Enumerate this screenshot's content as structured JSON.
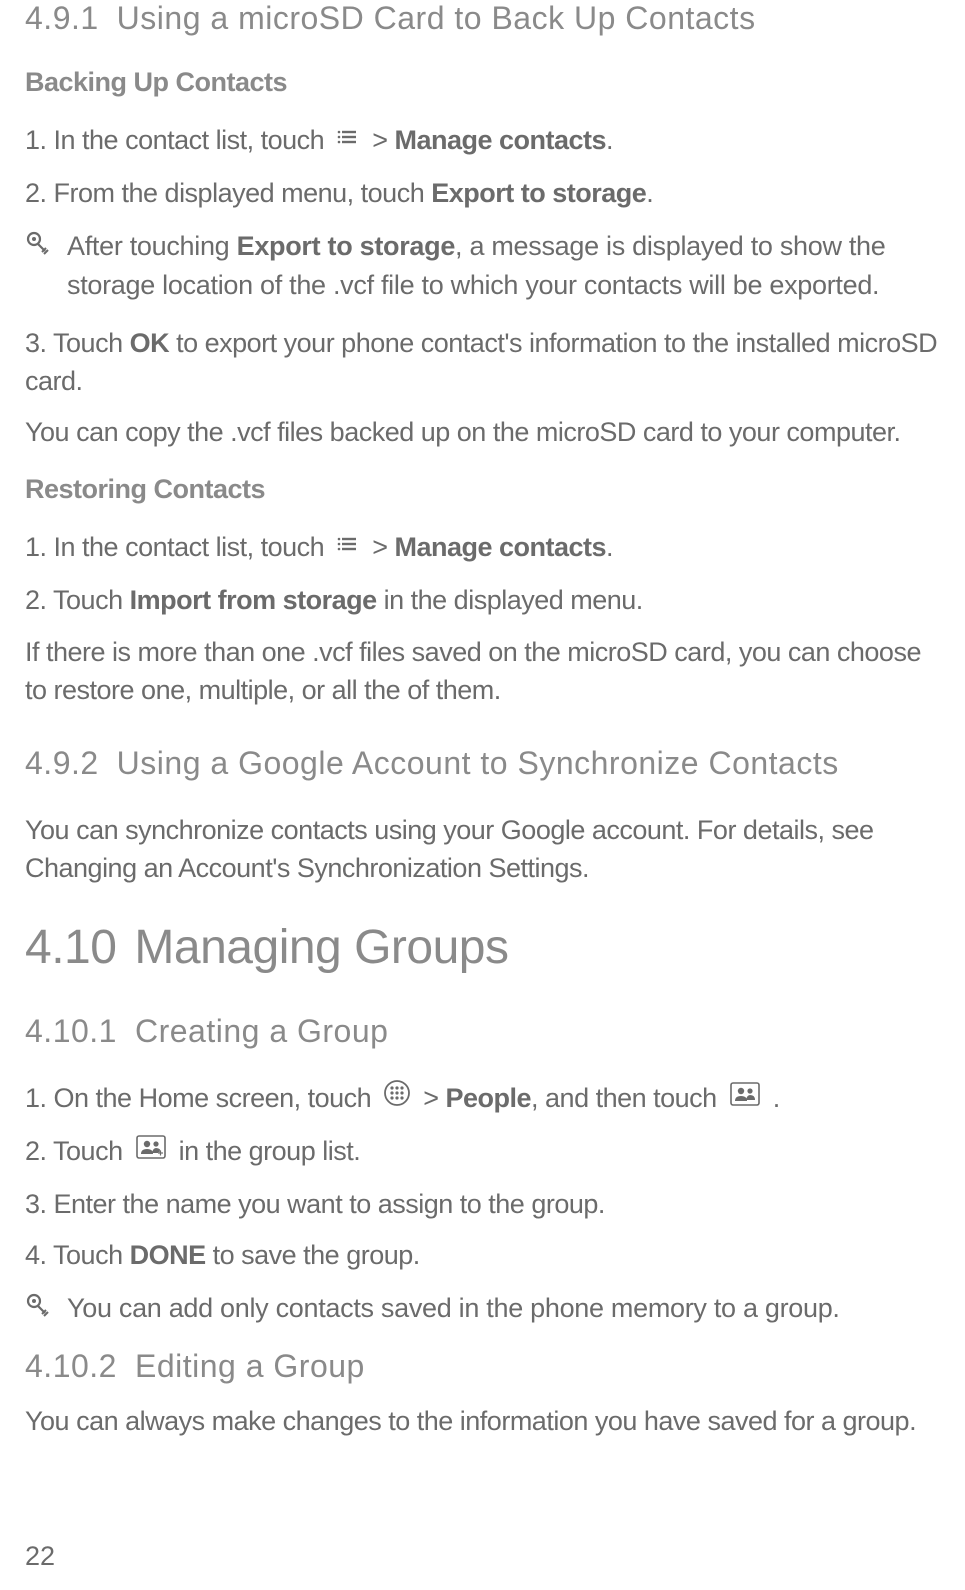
{
  "section_491": {
    "number": "4.9.1",
    "title": "Using a microSD Card to Back Up Contacts",
    "backup_heading": "Backing Up Contacts",
    "step1_a": "1. In the contact list, touch ",
    "step1_b": " > ",
    "step1_c": "Manage contacts",
    "step1_d": ".",
    "step2_a": "2. From the displayed menu, touch ",
    "step2_b": "Export to storage",
    "step2_c": ".",
    "note1_a": "After touching ",
    "note1_b": "Export to storage",
    "note1_c": ", a message is displayed to show the storage location of the .vcf file to which your contacts will be exported.",
    "step3_a": "3. Touch ",
    "step3_b": "OK",
    "step3_c": " to export your phone contact's information to the installed microSD card.",
    "para1": "You can copy the .vcf files backed up on the microSD card to your computer.",
    "restore_heading": "Restoring Contacts",
    "rstep1_a": "1. In the contact list, touch ",
    "rstep1_b": " > ",
    "rstep1_c": "Manage contacts",
    "rstep1_d": ".",
    "rstep2_a": "2. Touch ",
    "rstep2_b": "Import from storage",
    "rstep2_c": " in the displayed menu.",
    "rpara": "If there is more than one .vcf files saved on the microSD card, you can choose to restore one, multiple, or all the of them."
  },
  "section_492": {
    "number": "4.9.2",
    "title": "Using a Google Account to Synchronize Contacts",
    "para": "You can synchronize contacts using your Google account. For details, see Changing an Account's Synchronization Settings."
  },
  "section_410": {
    "number": "4.10",
    "title": "Managing Groups"
  },
  "section_4101": {
    "number": "4.10.1",
    "title": "Creating a Group",
    "step1_a": "1. On the Home screen, touch ",
    "step1_b": " > ",
    "step1_c": "People",
    "step1_d": ", and then touch ",
    "step1_e": " .",
    "step2_a": "2. Touch ",
    "step2_b": " in the group list.",
    "step3": "3. Enter the name you want to assign to the group.",
    "step4_a": "4. Touch ",
    "step4_b": "DONE",
    "step4_c": " to save the group.",
    "note": "You can add only contacts saved in the phone memory to a group."
  },
  "section_4102": {
    "number": "4.10.2",
    "title": "Editing a Group",
    "para": "You can always make changes to the information you have saved for a group."
  },
  "page_number": "22"
}
